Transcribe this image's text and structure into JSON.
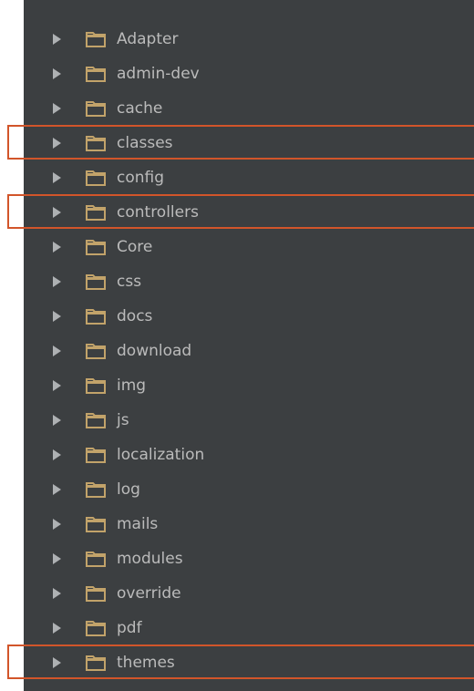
{
  "colors": {
    "panel_background": "#3c3f41",
    "text": "#bbbbbb",
    "arrow": "#aeb1b3",
    "folder": "#c2a36a",
    "highlight": "#d2552a"
  },
  "tree": {
    "items": [
      {
        "label": "Adapter",
        "icon": "folder-icon",
        "highlighted": false
      },
      {
        "label": "admin-dev",
        "icon": "folder-icon",
        "highlighted": false
      },
      {
        "label": "cache",
        "icon": "folder-icon",
        "highlighted": false
      },
      {
        "label": "classes",
        "icon": "folder-icon",
        "highlighted": true
      },
      {
        "label": "config",
        "icon": "folder-icon",
        "highlighted": false
      },
      {
        "label": "controllers",
        "icon": "folder-icon",
        "highlighted": true
      },
      {
        "label": "Core",
        "icon": "folder-icon",
        "highlighted": false
      },
      {
        "label": "css",
        "icon": "folder-icon",
        "highlighted": false
      },
      {
        "label": "docs",
        "icon": "folder-icon",
        "highlighted": false
      },
      {
        "label": "download",
        "icon": "folder-icon",
        "highlighted": false
      },
      {
        "label": "img",
        "icon": "folder-icon",
        "highlighted": false
      },
      {
        "label": "js",
        "icon": "folder-icon",
        "highlighted": false
      },
      {
        "label": "localization",
        "icon": "folder-icon",
        "highlighted": false
      },
      {
        "label": "log",
        "icon": "folder-icon",
        "highlighted": false
      },
      {
        "label": "mails",
        "icon": "folder-icon",
        "highlighted": false
      },
      {
        "label": "modules",
        "icon": "folder-icon",
        "highlighted": false
      },
      {
        "label": "override",
        "icon": "folder-icon",
        "highlighted": false
      },
      {
        "label": "pdf",
        "icon": "folder-icon",
        "highlighted": false
      },
      {
        "label": "themes",
        "icon": "folder-icon",
        "highlighted": true
      }
    ]
  }
}
